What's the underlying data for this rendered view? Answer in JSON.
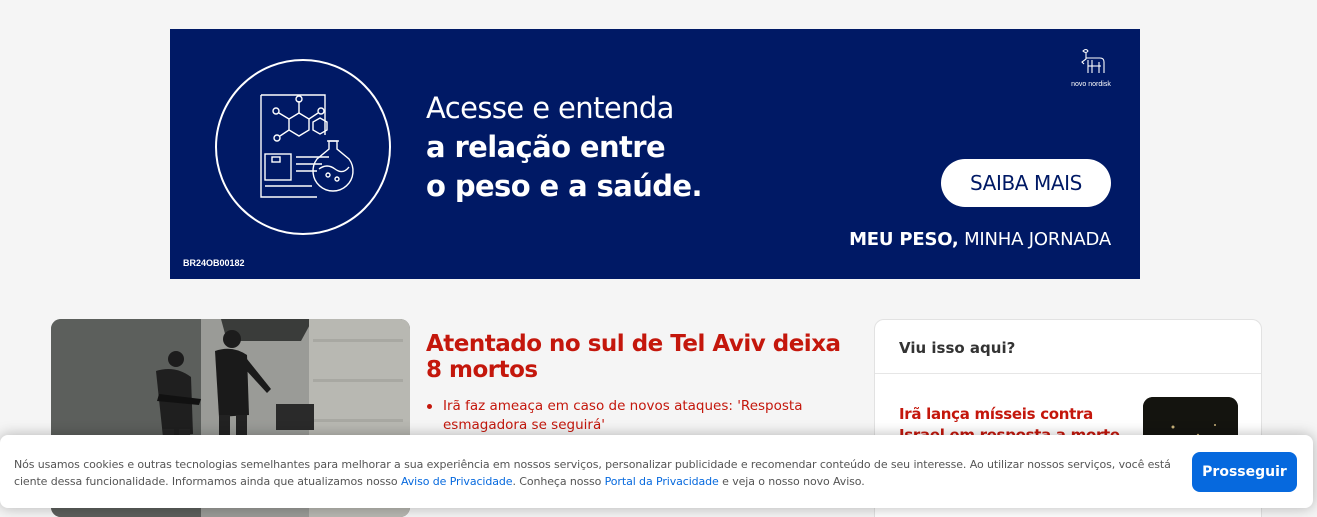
{
  "ad": {
    "headline_line1": "Acesse e entenda",
    "headline_line2": "a relação entre",
    "headline_line3": "o peso e a saúde.",
    "cta_label": "SAIBA MAIS",
    "tagline_bold": "MEU PESO,",
    "tagline_regular": " MINHA JORNADA",
    "code": "BR24OB00182",
    "brand": "novo nordisk",
    "illustration_icon": "document-molecule-flask-icon",
    "logo_icon": "apis-bull-icon",
    "background_color": "#001965"
  },
  "main_story": {
    "title": "Atentado no sul de Tel Aviv deixa 8 mortos",
    "related": [
      {
        "text": "Irã faz ameaça em caso de novos ataques: 'Resposta esmagadora se seguirá'"
      }
    ],
    "accent_color": "#c4170c"
  },
  "sidebar": {
    "header": "Viu isso aqui?",
    "item_title": "Irã lança mísseis contra Israel em resposta a morte de chefes"
  },
  "cookie_banner": {
    "text_part1": "Nós usamos cookies e outras tecnologias semelhantes para melhorar a sua experiência em nossos serviços, personalizar publicidade e recomendar conteúdo de seu interesse. Ao utilizar nossos serviços, você está ciente dessa funcionalidade. Informamos ainda que atualizamos nosso ",
    "privacy_notice_link": "Aviso de Privacidade",
    "text_part2": ". Conheça nosso ",
    "privacy_portal_link": "Portal da Privacidade",
    "text_part3": " e veja o nosso novo Aviso.",
    "button_label": "Prosseguir",
    "button_color": "#0669de"
  }
}
